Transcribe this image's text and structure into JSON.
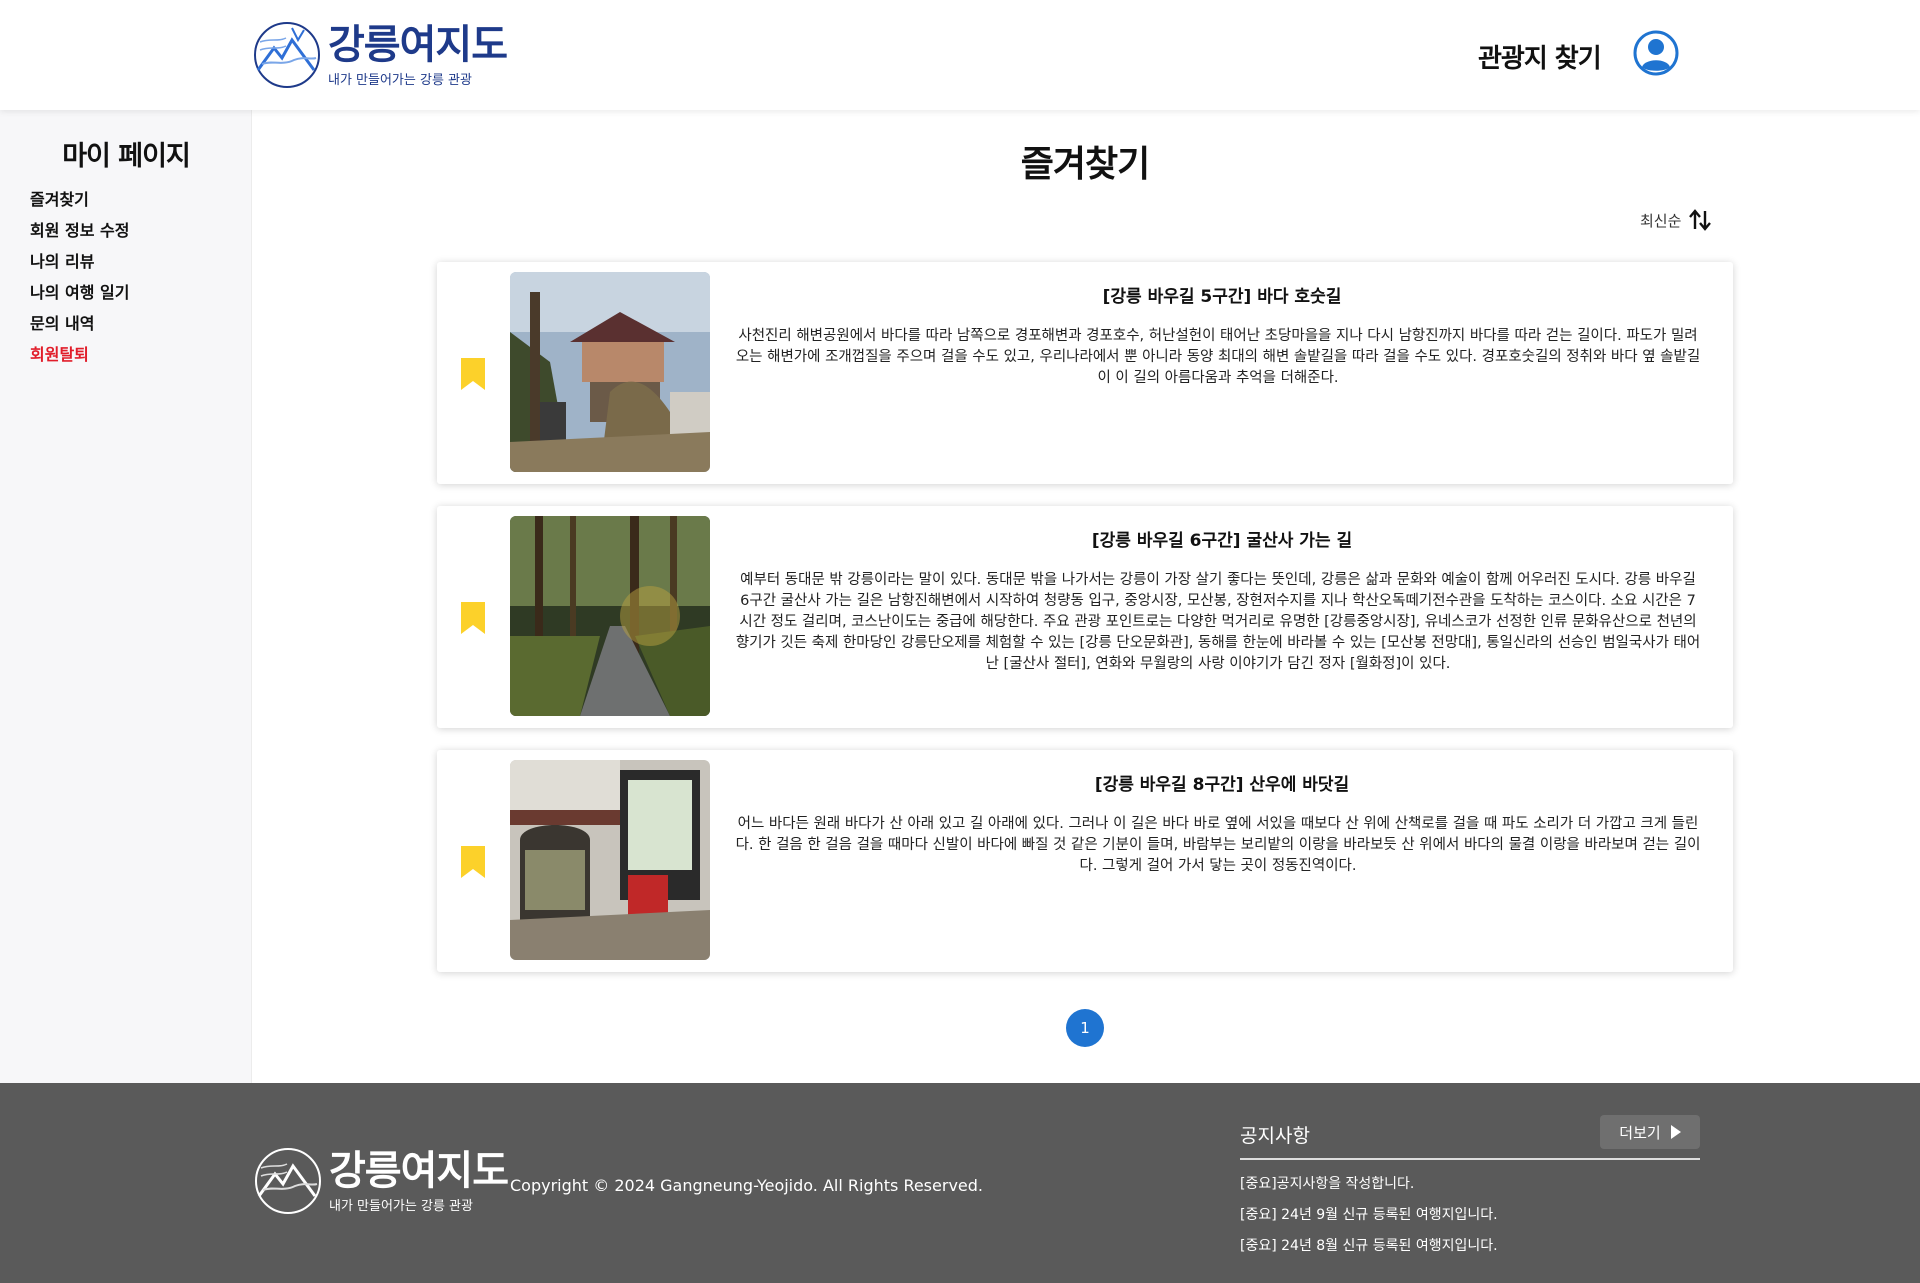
{
  "header": {
    "logo_title": "강릉여지도",
    "logo_sub": "내가 만들어가는 강릉 관광",
    "nav_link": "관광지 찾기",
    "brand_color": "#1e3a8a"
  },
  "sidebar": {
    "title": "마이 페이지",
    "items": [
      {
        "label": "즐겨찾기"
      },
      {
        "label": "회원 정보 수정"
      },
      {
        "label": "나의 리뷰"
      },
      {
        "label": "나의 여행 일기"
      },
      {
        "label": "문의 내역"
      },
      {
        "label": "회원탈퇴",
        "color": "#e11d2a"
      }
    ]
  },
  "main": {
    "title": "즐겨찾기",
    "sort_label": "최신순",
    "cards": [
      {
        "title": "[강릉 바우길 5구간] 바다 호숫길",
        "description": "사천진리 해변공원에서 바다를 따라 남쪽으로 경포해변과 경포호수, 허난설헌이 태어난 초당마을을 지나 다시 남항진까지 바다를 따라 걷는 길이다. 파도가 밀려오는 해변가에 조개껍질을 주으며 걸을 수도 있고, 우리나라에서 뿐 아니라 동양 최대의 해변 솔밭길을 따라 걸을 수도 있다. 경포호숫길의 정취와 바다 옆 솔밭길이 이 길의 아름다움과 추억을 더해준다."
      },
      {
        "title": "[강릉 바우길 6구간] 굴산사 가는 길",
        "description": "예부터 동대문 밖 강릉이라는 말이 있다. 동대문 밖을 나가서는 강릉이 가장 살기 좋다는 뜻인데, 강릉은 삶과 문화와 예술이 함께 어우러진 도시다. 강릉 바우길 6구간 굴산사 가는 길은 남항진해변에서 시작하여 청량동 입구, 중앙시장, 모산봉, 장현저수지를 지나 학산오독떼기전수관을 도착하는 코스이다. 소요 시간은 7시간 정도 걸리며, 코스난이도는 중급에 해당한다. 주요 관광 포인트로는 다양한 먹거리로 유명한 [강릉중앙시장], 유네스코가 선정한 인류 문화유산으로 천년의 향기가 깃든 축제 한마당인 강릉단오제를 체험할 수 있는 [강릉 단오문화관], 동해를 한눈에 바라볼 수 있는 [모산봉 전망대], 통일신라의 선승인 범일국사가 태어난 [굴산사 절터], 연화와 무월랑의 사랑 이야기가 담긴 정자 [월화정]이 있다."
      },
      {
        "title": "[강릉 바우길 8구간] 산우에 바닷길",
        "description": "어느 바다든 원래 바다가 산 아래 있고 길 아래에 있다. 그러나 이 길은 바다 바로 옆에 서있을 때보다 산 위에 산책로를 걸을 때 파도 소리가 더 가깝고 크게 들린다. 한 걸음 한 걸음 걸을 때마다 신발이 바다에 빠질 것 같은 기분이 들며, 바람부는 보리밭의 이랑을 바라보듯 산 위에서 바다의 물결 이랑을 바라보며 걷는 길이다. 그렇게 걸어 가서 닿는 곳이 정동진역이다."
      }
    ],
    "bookmark_color": "#fcd12a",
    "pagination": {
      "current": "1",
      "color": "#1f74d1"
    }
  },
  "footer": {
    "logo_title": "강릉여지도",
    "logo_sub": "내가 만들어가는 강릉 관광",
    "copyright": "Copyright © 2024 Gangneung-Yeojido. All Rights Reserved.",
    "notice_title": "공지사항",
    "more_label": "더보기",
    "notices": [
      {
        "label": "[중요]공지사항을 작성합니다."
      },
      {
        "label": "[중요] 24년 9월 신규 등록된 여행지입니다."
      },
      {
        "label": "[중요] 24년 8월 신규 등록된 여행지입니다."
      }
    ],
    "bg_color": "#5a5a5a"
  }
}
